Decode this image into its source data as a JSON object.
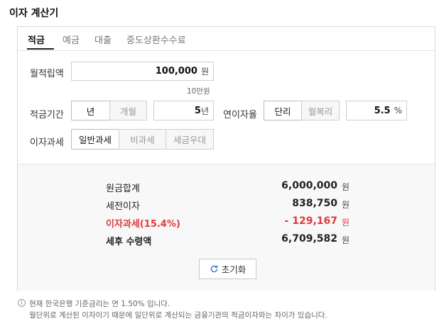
{
  "title": "이자 계산기",
  "tabs": [
    {
      "label": "적금",
      "active": true
    },
    {
      "label": "예금",
      "active": false
    },
    {
      "label": "대출",
      "active": false
    },
    {
      "label": "중도상환수수료",
      "active": false
    }
  ],
  "form": {
    "monthly_label": "월적립액",
    "monthly_value": "100,000",
    "monthly_unit": "원",
    "monthly_hint": "10만원",
    "period_label": "적금기간",
    "period_options": [
      "년",
      "개월"
    ],
    "period_value": "5",
    "period_unit": "년",
    "rate_label": "연이자율",
    "rate_options": [
      "단리",
      "월복리"
    ],
    "rate_value": "5.5",
    "rate_unit": "%",
    "tax_label": "이자과세",
    "tax_options": [
      "일반과세",
      "비과세",
      "세금우대"
    ]
  },
  "results": {
    "principal_label": "원금합계",
    "principal_value": "6,000,000",
    "pretax_label": "세전이자",
    "pretax_value": "838,750",
    "tax_label": "이자과세(15.4%)",
    "tax_value": "- 129,167",
    "net_label": "세후 수령액",
    "net_value": "6,709,582",
    "unit": "원"
  },
  "reset_label": "초기화",
  "notes": [
    "현재 한국은행 기준금리는 연 1.50% 입니다.",
    "월단위로 계산된 이자이기 때문에 일단위로 계산되는 금융기관의 적금이자와는 차이가 있습니다."
  ],
  "colors": {
    "accent_red": "#e03b3b",
    "reset_icon": "#3a7bd5"
  },
  "icons": {
    "reset": "refresh-icon",
    "info": "info-icon"
  }
}
